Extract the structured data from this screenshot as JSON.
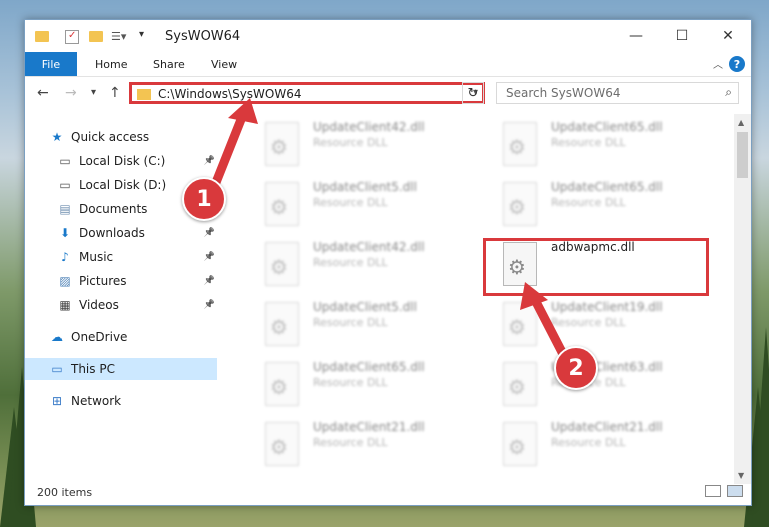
{
  "window": {
    "title": "SysWOW64",
    "minimize": "—",
    "maximize": "☐",
    "close": "✕"
  },
  "ribbon": {
    "tabs": [
      "File",
      "Home",
      "Share",
      "View"
    ],
    "help": "?"
  },
  "navigation": {
    "address_path": "C:\\Windows\\SysWOW64",
    "search_placeholder": "Search SysWOW64"
  },
  "sidebar": {
    "items": [
      {
        "label": "Quick access",
        "icon": "star-icon",
        "pinned": false
      },
      {
        "label": "Local Disk (C:)",
        "icon": "drive-icon",
        "pinned": true
      },
      {
        "label": "Local Disk (D:)",
        "icon": "drive-icon",
        "pinned": true
      },
      {
        "label": "Documents",
        "icon": "documents-icon",
        "pinned": true
      },
      {
        "label": "Downloads",
        "icon": "download-icon",
        "pinned": true
      },
      {
        "label": "Music",
        "icon": "music-icon",
        "pinned": true
      },
      {
        "label": "Pictures",
        "icon": "pictures-icon",
        "pinned": true
      },
      {
        "label": "Videos",
        "icon": "videos-icon",
        "pinned": true
      },
      {
        "label": "OneDrive",
        "icon": "cloud-icon",
        "pinned": false
      },
      {
        "label": "This PC",
        "icon": "pc-icon",
        "pinned": false,
        "selected": true
      },
      {
        "label": "Network",
        "icon": "network-icon",
        "pinned": false
      }
    ]
  },
  "files": [
    {
      "name": "UpdateClient42.dll",
      "type": "Resource DLL",
      "blurred": true
    },
    {
      "name": "UpdateClient65.dll",
      "type": "Resource DLL",
      "blurred": true
    },
    {
      "name": "UpdateClient5.dll",
      "type": "Resource DLL",
      "blurred": true
    },
    {
      "name": "UpdateClient65.dll",
      "type": "Resource DLL",
      "blurred": true
    },
    {
      "name": "UpdateClient42.dll",
      "type": "Resource DLL",
      "blurred": true
    },
    {
      "name": "adbwapmc.dll",
      "type": "",
      "blurred": false
    },
    {
      "name": "UpdateClient5.dll",
      "type": "Resource DLL",
      "blurred": true
    },
    {
      "name": "UpdateClient19.dll",
      "type": "Resource DLL",
      "blurred": true
    },
    {
      "name": "UpdateClient65.dll",
      "type": "Resource DLL",
      "blurred": true
    },
    {
      "name": "UpdateClient63.dll",
      "type": "Resource DLL",
      "blurred": true
    },
    {
      "name": "UpdateClient21.dll",
      "type": "Resource DLL",
      "blurred": true
    },
    {
      "name": "UpdateClient21.dll",
      "type": "Resource DLL",
      "blurred": true
    }
  ],
  "status": {
    "item_count": "200 items"
  },
  "callouts": {
    "one": "1",
    "two": "2"
  },
  "colors": {
    "accent": "#1979ca",
    "highlight": "#d9393c",
    "selected": "#cce8ff"
  }
}
